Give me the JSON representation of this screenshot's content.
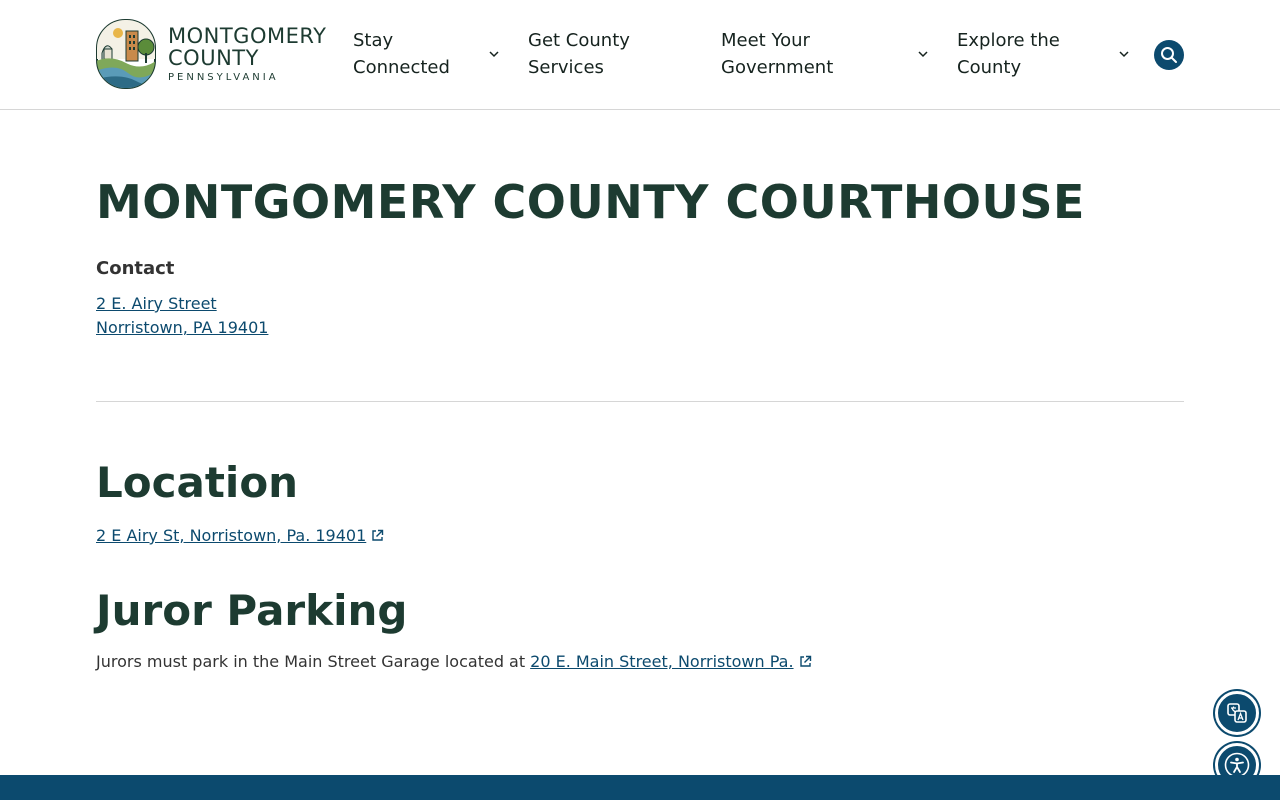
{
  "header": {
    "logo": {
      "line1": "MONTGOMERY",
      "line2": "COUNTY",
      "line3": "PENNSYLVANIA"
    },
    "nav": [
      {
        "label": "Stay Connected",
        "has_dropdown": true
      },
      {
        "label": "Get County Services",
        "has_dropdown": false
      },
      {
        "label": "Meet Your Government",
        "has_dropdown": true
      },
      {
        "label": "Explore the County",
        "has_dropdown": true
      }
    ],
    "search_icon": "search-icon"
  },
  "main": {
    "title": "MONTGOMERY COUNTY COURTHOUSE",
    "contact": {
      "heading": "Contact",
      "address_line1": "2 E. Airy Street",
      "address_line2": "Norristown, PA 19401"
    },
    "location": {
      "heading": "Location",
      "link": "2 E Airy St, Norristown, Pa. 19401"
    },
    "juror_parking": {
      "heading": "Juror Parking",
      "text": "Jurors must park in the Main Street Garage located at",
      "link": "20 E. Main Street, Norristown Pa."
    }
  },
  "floating": {
    "translate_icon": "translate-icon",
    "accessibility_icon": "accessibility-icon"
  },
  "colors": {
    "brand_green": "#1d3b31",
    "link_blue": "#0c4a6e",
    "footer_blue": "#0c4a6e"
  }
}
